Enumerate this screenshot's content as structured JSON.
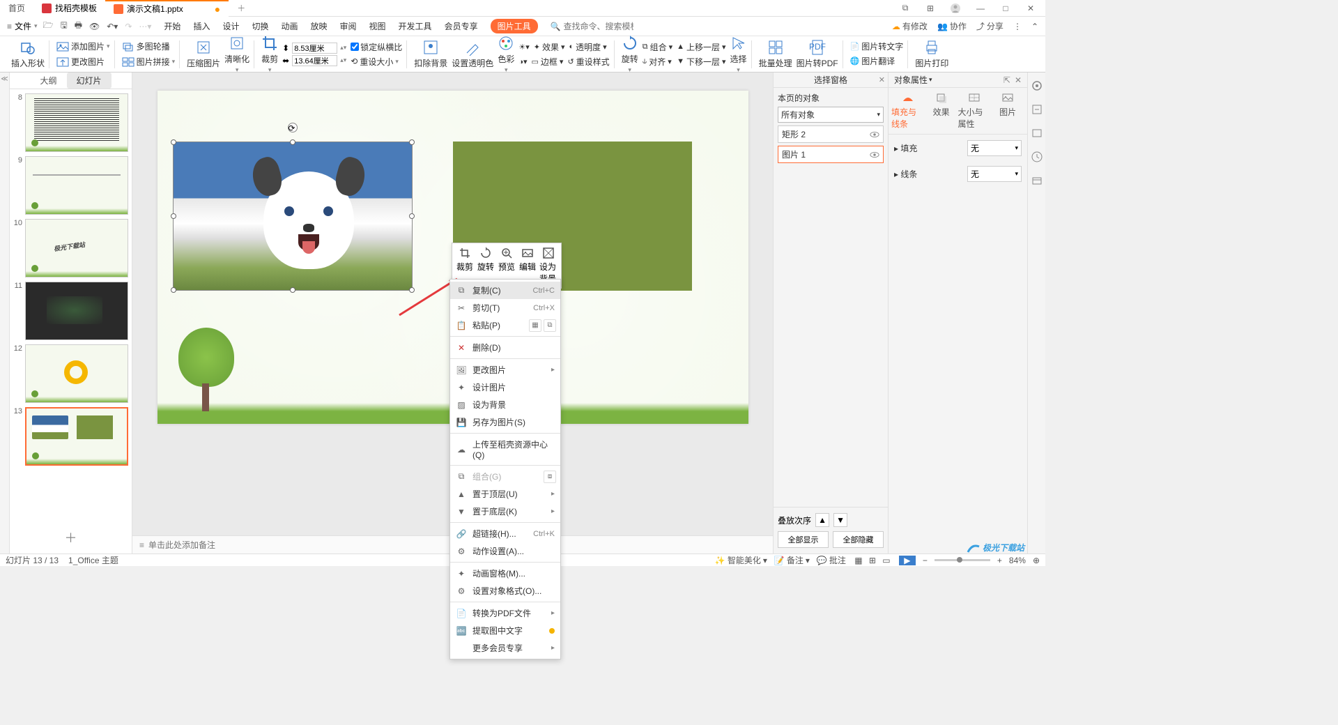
{
  "tabs": {
    "home": "首页",
    "template": "找稻壳模板",
    "active": "演示文稿1.pptx"
  },
  "menu": {
    "file": "文件",
    "items": [
      "开始",
      "插入",
      "设计",
      "切换",
      "动画",
      "放映",
      "审阅",
      "视图",
      "开发工具",
      "会员专享"
    ],
    "tool": "图片工具",
    "search_placeholder": "查找命令、搜索模板",
    "right": {
      "pending": "有修改",
      "collab": "协作",
      "share": "分享"
    }
  },
  "ribbon": {
    "insert_shape": "插入形状",
    "add_image": "添加图片",
    "multi_outline": "多图轮播",
    "change_image": "更改图片",
    "image_join": "图片拼接",
    "compress": "压缩图片",
    "clarify": "清晰化",
    "crop": "裁剪",
    "width": "8.53厘米",
    "height": "13.64厘米",
    "lock": "锁定纵横比",
    "reset_size": "重设大小",
    "remove_bg": "扣除背景",
    "set_transparent_color": "设置透明色",
    "color": "色彩",
    "effects": "效果",
    "transparency": "透明度",
    "border": "边框",
    "reset_style": "重设样式",
    "rotate": "旋转",
    "combine": "组合",
    "align": "对齐",
    "bring_fwd": "上移一层",
    "send_back": "下移一层",
    "select": "选择",
    "batch": "批量处理",
    "to_pdf": "图片转PDF",
    "to_text": "图片转文字",
    "translate": "图片翻译",
    "print": "图片打印"
  },
  "slidepanel": {
    "outline": "大纲",
    "slides": "幻灯片",
    "numbers": [
      "8",
      "9",
      "10",
      "11",
      "12",
      "13"
    ]
  },
  "float_toolbar": {
    "crop": "裁剪",
    "rotate": "旋转",
    "preview": "预览",
    "edit": "编辑",
    "set_bg": "设为背景"
  },
  "context_menu": {
    "copy": "复制(C)",
    "copy_sc": "Ctrl+C",
    "cut": "剪切(T)",
    "cut_sc": "Ctrl+X",
    "paste": "粘贴(P)",
    "delete": "删除(D)",
    "change_img": "更改图片",
    "design_img": "设计图片",
    "set_bg": "设为背景",
    "save_as_img": "另存为图片(S)",
    "upload_res": "上传至稻壳资源中心(Q)",
    "group": "组合(G)",
    "to_front": "置于顶层(U)",
    "to_back": "置于底层(K)",
    "hyperlink": "超链接(H)...",
    "hyperlink_sc": "Ctrl+K",
    "action": "动作设置(A)...",
    "anim_pane": "动画窗格(M)...",
    "format_obj": "设置对象格式(O)...",
    "to_pdf": "转换为PDF文件",
    "extract_text": "提取图中文字",
    "more_vip": "更多会员专享"
  },
  "selection_pane": {
    "title": "选择窗格",
    "page_objects": "本页的对象",
    "all_objects": "所有对象",
    "items": [
      "矩形 2",
      "图片 1"
    ],
    "stack_order": "叠放次序",
    "show_all": "全部显示",
    "hide_all": "全部隐藏"
  },
  "prop_pane": {
    "title": "对象属性",
    "tabs": {
      "fill_line": "填充与线条",
      "effects": "效果",
      "size_prop": "大小与属性",
      "image": "图片"
    },
    "fill": "填充",
    "line": "线条",
    "none": "无"
  },
  "notes": {
    "placeholder": "单击此处添加备注"
  },
  "statusbar": {
    "slide_info": "幻灯片 13 / 13",
    "theme": "1_Office 主题",
    "smart_beautify": "智能美化",
    "remarks": "备注",
    "comments": "批注",
    "zoom": "84%"
  },
  "watermark": "极光下载站"
}
